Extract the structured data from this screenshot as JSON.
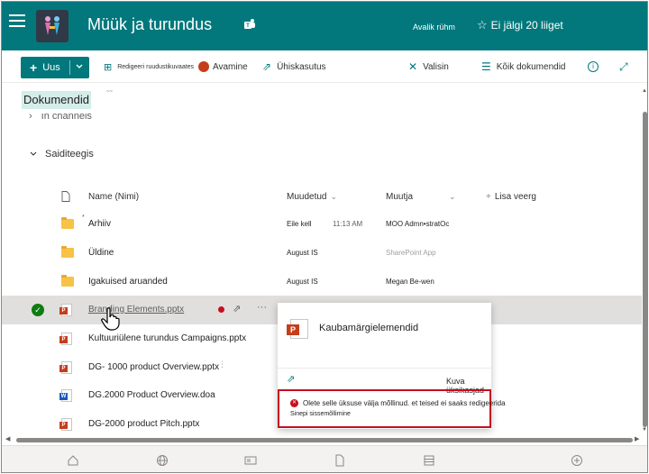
{
  "header": {
    "site_title": "Müük ja turundus",
    "group_type": "Avalik rühm",
    "follow_label": "Ei jälgi 20 liiget",
    "brand_color": "#03787c"
  },
  "commandbar": {
    "new_label": "Uus",
    "edit_grid_label": "Redigeeri ruudustikuvaates",
    "open_label": "Avamine",
    "share_label": "Ühiskasutus",
    "select_label": "Valisin",
    "all_docs_label": "Kõik dokumendid"
  },
  "library": {
    "title": "Dokumendid",
    "title_sup": "~~",
    "in_channels": "In channels",
    "section": "Saiditeegis"
  },
  "columns": {
    "name": "Name (Nimi)",
    "modified": "Muudetud",
    "modified_by": "Muutja",
    "add_column": "Lisa veerg"
  },
  "rows": [
    {
      "type": "folder",
      "name": "Arhiiv",
      "modified": "Eile kell",
      "time": "11:13 AM",
      "author": "MOO Admn•stratOc",
      "author_grey": false
    },
    {
      "type": "folder",
      "name": "Üldine",
      "modified": "August IS",
      "time": "",
      "author": "SharePoint App",
      "author_grey": true
    },
    {
      "type": "folder",
      "name": "Igakuised aruanded",
      "modified": "August IS",
      "time": "",
      "author": "Megan Be-wen",
      "author_grey": false
    },
    {
      "type": "ppt",
      "name": "Branding Elements.pptx",
      "modified": "",
      "time": "",
      "author": "",
      "author_grey": false
    },
    {
      "type": "ppt",
      "name": "Kultuuriülene turundus Campaigns.pptx",
      "modified": "",
      "time": "",
      "author": "",
      "author_grey": false
    },
    {
      "type": "ppt",
      "name": "DG- 1000 product Overview.pptx",
      "modified": "",
      "time": "",
      "author": "",
      "author_grey": false
    },
    {
      "type": "doc",
      "name": "DG.2000 Product Overview.doa",
      "modified": "",
      "time": "",
      "author": "",
      "author_grey": false
    },
    {
      "type": "ppt",
      "name": "DG-2000 product Pitch.pptx",
      "modified": "",
      "time": "",
      "author": "",
      "author_grey": false
    }
  ],
  "card": {
    "title": "Kaubamärgielemendid",
    "details_label": "Kuva üksikasjad",
    "warning_message": "Olete selle üksuse välja mõllinud. et teised ei saaks redigeerida",
    "warning_sub": "Sinepi sissemõllimine"
  }
}
